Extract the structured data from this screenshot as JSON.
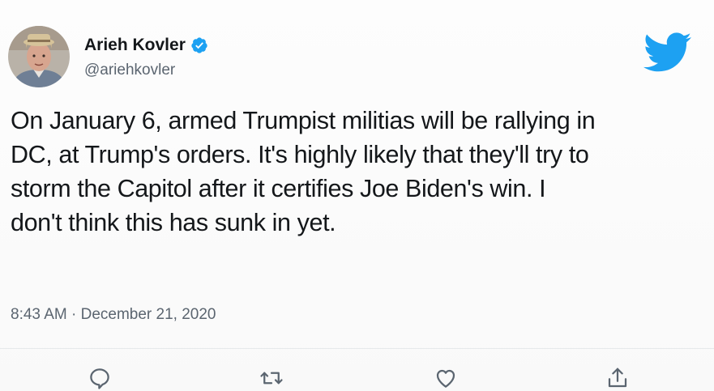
{
  "author": {
    "name": "Arieh Kovler",
    "handle": "@ariehkovler",
    "verified": true
  },
  "tweet": {
    "lines": [
      "On January 6, armed Trumpist militias will be rallying in",
      "DC, at Trump's orders. It's highly likely that they'll try to",
      "storm the Capitol after it certifies Joe Biden's win. I",
      "don't think this has sunk in yet."
    ],
    "timestamp": "8:43 AM · December 21, 2020"
  },
  "actions": [
    {
      "icon": "reply-icon"
    },
    {
      "icon": "retweet-icon"
    },
    {
      "icon": "like-icon"
    },
    {
      "icon": "share-icon"
    }
  ],
  "colors": {
    "brand": "#1da1f2",
    "text": "#14171a",
    "secondary": "#5b6570"
  }
}
